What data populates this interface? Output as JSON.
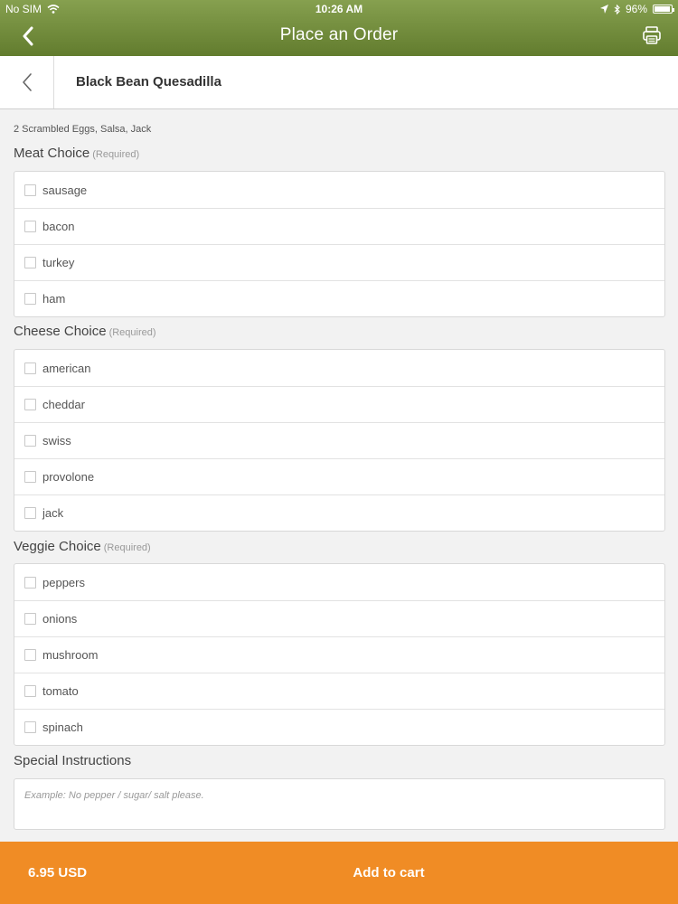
{
  "status_bar": {
    "carrier": "No SIM",
    "time": "10:26 AM",
    "battery": "96%",
    "battery_level": 0.96
  },
  "nav": {
    "title": "Place an Order",
    "back_icon": "chevron-left-icon",
    "print_icon": "printer-icon"
  },
  "item": {
    "title": "Black Bean Quesadilla",
    "description": "2 Scrambled Eggs, Salsa, Jack"
  },
  "sections": [
    {
      "title": "Meat Choice",
      "required_label": "(Required)",
      "options": [
        "sausage",
        "bacon",
        "turkey",
        "ham"
      ]
    },
    {
      "title": "Cheese Choice",
      "required_label": "(Required)",
      "options": [
        "american",
        "cheddar",
        "swiss",
        "provolone",
        "jack"
      ]
    },
    {
      "title": "Veggie Choice",
      "required_label": "(Required)",
      "options": [
        "peppers",
        "onions",
        "mushroom",
        "tomato",
        "spinach"
      ]
    }
  ],
  "special": {
    "title": "Special Instructions",
    "placeholder": "Example: No pepper / sugar/ salt please.",
    "value": ""
  },
  "footer": {
    "price": "6.95 USD",
    "add_to_cart": "Add to cart"
  },
  "colors": {
    "header_green": "#6f8a3a",
    "footer_orange": "#f08c25"
  }
}
